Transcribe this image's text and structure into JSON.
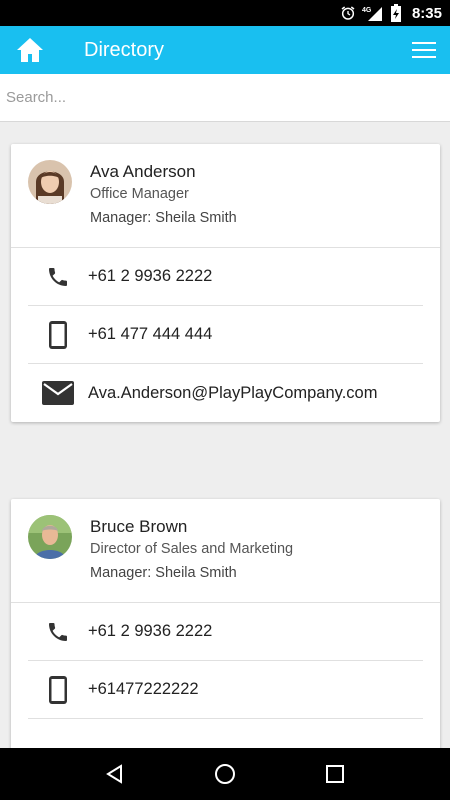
{
  "status_bar": {
    "time": "8:35",
    "network": "4G"
  },
  "app_bar": {
    "title": "Directory",
    "accent_color": "#19bff0"
  },
  "search": {
    "placeholder": "Search...",
    "value": ""
  },
  "contacts": [
    {
      "name": "Ava Anderson",
      "title": "Office Manager",
      "manager": "Manager: Sheila Smith",
      "phone": "+61 2 9936 2222",
      "mobile": "+61 477 444 444",
      "email": "Ava.Anderson@PlayPlayCompany.com"
    },
    {
      "name": "Bruce Brown",
      "title": "Director of Sales and Marketing",
      "manager": "Manager: Sheila Smith",
      "phone": "+61 2 9936 2222",
      "mobile": "+61477222222"
    }
  ]
}
